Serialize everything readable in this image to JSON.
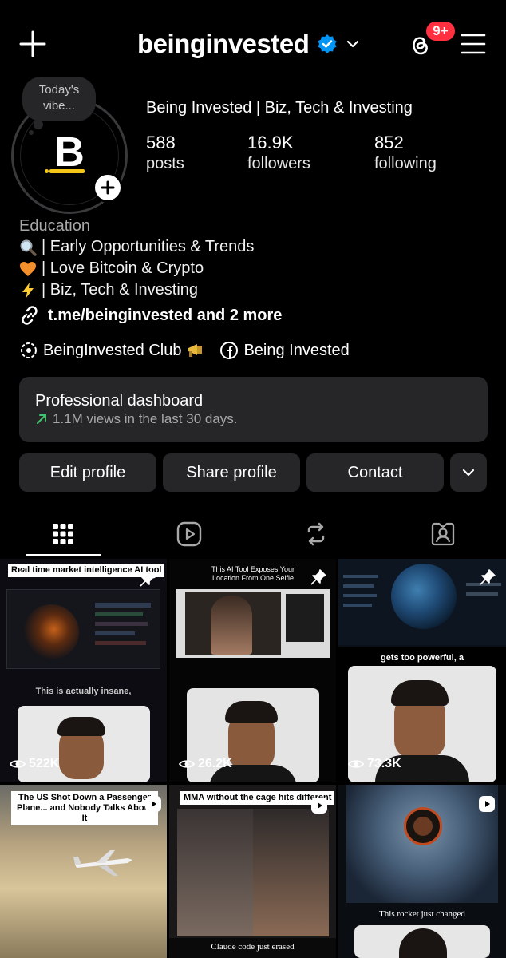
{
  "header": {
    "username": "beinginvested",
    "notification_badge": "9+"
  },
  "profile": {
    "note": "Today's vibe...",
    "avatar_letter": "B",
    "display_name": "Being Invested | Biz, Tech & Investing",
    "stats": {
      "posts_count": "588",
      "posts_label": "posts",
      "followers_count": "16.9K",
      "followers_label": "followers",
      "following_count": "852",
      "following_label": "following"
    },
    "category": "Education",
    "bio_lines": [
      {
        "icon": "magnifier-emoji",
        "text": "| Early Opportunities & Trends"
      },
      {
        "icon": "orange-heart-emoji",
        "text": "| Love Bitcoin & Crypto"
      },
      {
        "icon": "lightning-emoji",
        "text": "| Biz, Tech & Investing"
      }
    ],
    "link_text": "t.me/beinginvested and 2 more",
    "chips": {
      "club": "BeingInvested Club",
      "facebook": "Being Invested"
    }
  },
  "dashboard": {
    "title": "Professional dashboard",
    "subtitle": "1.1M views in the last 30 days."
  },
  "actions": {
    "edit": "Edit profile",
    "share": "Share profile",
    "contact": "Contact"
  },
  "tabs": [
    "grid-icon",
    "reels-icon",
    "reposts-icon",
    "tagged-icon"
  ],
  "grid": {
    "p1_caption": "Real time market intelligence AI tool",
    "p2_caption": "This AI Tool Exposes Your Location From One Selfie",
    "p4_caption": "This is actually insane,",
    "p4_views": "522K",
    "p5_views": "26.2K",
    "p6_caption": "gets too powerful, a",
    "p6_views": "73.3K",
    "p7_caption": "The US Shot Down a Passenger Plane... and Nobody Talks About It",
    "p8_caption": "MMA without the cage hits different",
    "p8_bottom": "Claude code just erased",
    "p9_bottom": "This rocket just changed"
  },
  "colors": {
    "background": "#000000",
    "surface": "#262629",
    "badge": "#ff3040",
    "verified": "#0095f6",
    "trend_green": "#3ec46d",
    "avatar_accent": "#f5c518"
  }
}
